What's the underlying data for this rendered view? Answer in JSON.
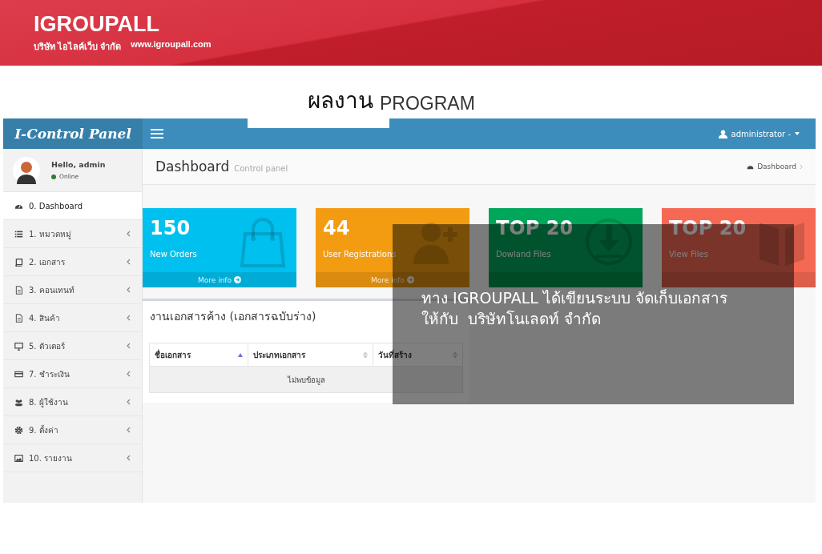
{
  "banner": {
    "brand": "IGROUPALL",
    "tagline": "บริษัท ไอไลค์เว็บ จำกัด",
    "website": "www.igroupall.com"
  },
  "heading": {
    "title": "ผลงาน",
    "subtitle": "PROGRAM"
  },
  "app": {
    "logo": "I-Control Panel",
    "user_menu": "administrator -",
    "user": {
      "greeting": "Hello, admin",
      "status": "Online"
    },
    "menu": [
      {
        "label": "0. Dashboard",
        "kind": "dashboard",
        "selected": true,
        "has_submenu": false
      },
      {
        "label": "1. หมวดหมู่",
        "kind": "list",
        "selected": false,
        "has_submenu": true
      },
      {
        "label": "2. เอกสาร",
        "kind": "book",
        "selected": false,
        "has_submenu": true
      },
      {
        "label": "3. คอนเทนท์",
        "kind": "file",
        "selected": false,
        "has_submenu": true
      },
      {
        "label": "4. สินค้า",
        "kind": "file",
        "selected": false,
        "has_submenu": true
      },
      {
        "label": "5. ตัวเตอร์",
        "kind": "monitor",
        "selected": false,
        "has_submenu": true
      },
      {
        "label": "7. ชำระเงิน",
        "kind": "card",
        "selected": false,
        "has_submenu": true
      },
      {
        "label": "8. ผู้ใช้งาน",
        "kind": "users",
        "selected": false,
        "has_submenu": true
      },
      {
        "label": "9. ตั้งค่า",
        "kind": "gear",
        "selected": false,
        "has_submenu": true
      },
      {
        "label": "10. รายงาน",
        "kind": "chart",
        "selected": false,
        "has_submenu": true
      }
    ],
    "page_title": "Dashboard",
    "page_subtitle": "Control panel",
    "breadcrumb": "Dashboard",
    "cards": [
      {
        "value": "150",
        "label": "New Orders",
        "link": "More info",
        "color": "#00c0ef",
        "kind": "bag"
      },
      {
        "value": "44",
        "label": "User Registrations",
        "link": "More info",
        "color": "#f39c12",
        "kind": "user-plus"
      },
      {
        "value": "TOP 20",
        "label": "Dowland Files",
        "color": "#00a65a",
        "kind": "download"
      },
      {
        "value": "TOP 20",
        "label": "View Files",
        "color": "#f56954",
        "kind": "book"
      }
    ],
    "box": {
      "title": "งานเอกสารค้าง (เอกสารฉบับร่าง)",
      "columns": [
        {
          "label": "ชื่อเอกสาร",
          "sorted": true
        },
        {
          "label": "ประเภทเอกสาร",
          "sorted": false
        },
        {
          "label": "วันที่สร้าง",
          "sorted": false
        }
      ],
      "empty": "ไม่พบข้อมูล"
    }
  },
  "overlay": {
    "lines": [
      "ทาง IGROUPALL ได้เขียนระบบ จัดเก็บเอกสาร",
      "ให้กับ  บริษัทโนเลดท์ จำกัด"
    ]
  }
}
